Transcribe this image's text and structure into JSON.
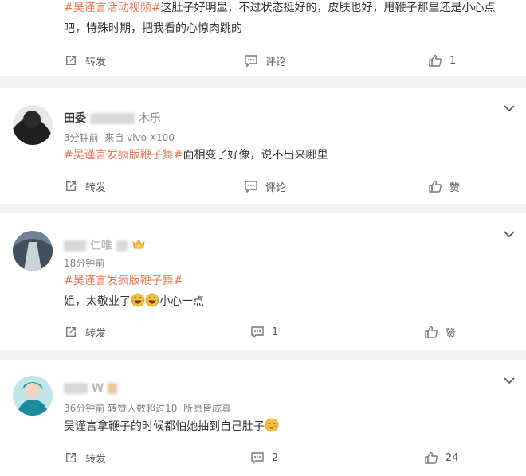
{
  "comment0": {
    "tag": "#吴谨言活动视频#",
    "text_line1": "这肚子好明显，不过状态挺好的，皮肤也好，甩鞭子那里还是小心点",
    "text_line2": "吧，特殊时期，把我看的心惊肉跳的",
    "repost": "转发",
    "comment": "评论",
    "likes": "1"
  },
  "comment1": {
    "name_visible": "田委",
    "name_tail": "木乐",
    "time": "3分钟前",
    "source": "来自 vivo X100",
    "tag": "#吴谨言发疯版鞭子舞#",
    "text": "面相变了好像，说不出来哪里",
    "repost": "转发",
    "comment": "评论",
    "like": "赞"
  },
  "comment2": {
    "name_visible": "仁唯",
    "time": "18分钟前",
    "tag": "#吴谨言发疯版鞭子舞#",
    "text_a": "姐，太敬业了",
    "text_b": "小心一点",
    "repost": "转发",
    "comments": "1",
    "like": "赞"
  },
  "comment3": {
    "name_visible": "W",
    "time": "36分钟前",
    "reposts_info": "转赞人数超过10",
    "badge": "所愿皆成真",
    "text": "吴谨言拿鞭子的时候都怕她抽到自己肚子",
    "repost": "转发",
    "comments": "2",
    "likes": "24"
  },
  "icons": {
    "repost": "repost-icon",
    "comment": "comment-icon",
    "like": "thumbs-up-icon",
    "menu": "chevron-down-icon",
    "crown": "crown-badge-icon",
    "laugh_cry": "laugh-cry-emoji",
    "shy": "shy-emoji"
  },
  "colors": {
    "tag": "#eb7350",
    "text": "#333333",
    "meta": "#808080"
  }
}
